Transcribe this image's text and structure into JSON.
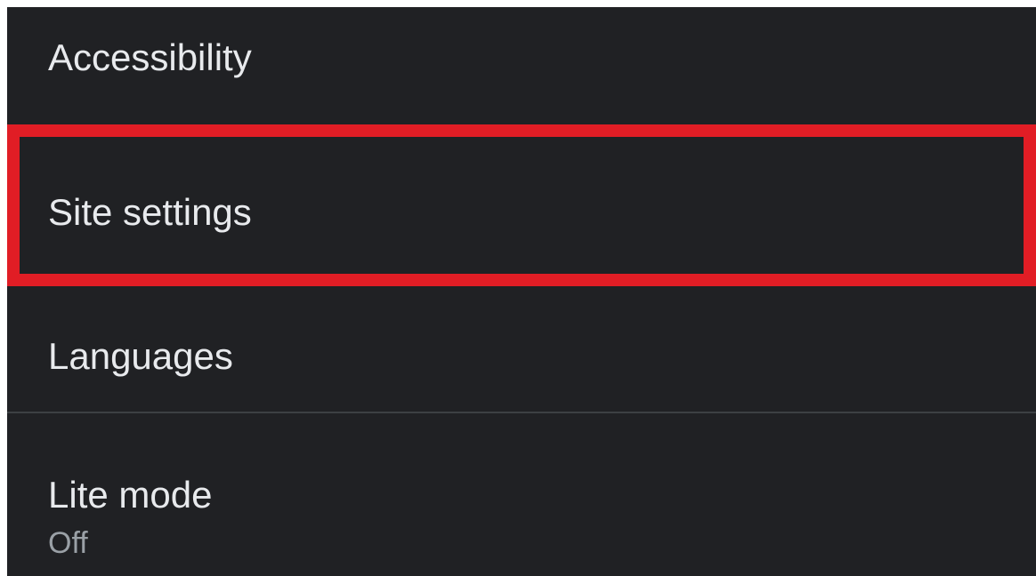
{
  "settings": {
    "items": [
      {
        "label": "Accessibility"
      },
      {
        "label": "Site settings",
        "highlighted": true
      },
      {
        "label": "Languages"
      },
      {
        "label": "Lite mode",
        "summary": "Off"
      }
    ]
  },
  "colors": {
    "background": "#202124",
    "text": "#e8eaed",
    "secondary_text": "#9aa0a6",
    "highlight_border": "#e11d25",
    "divider": "#3c4043"
  }
}
